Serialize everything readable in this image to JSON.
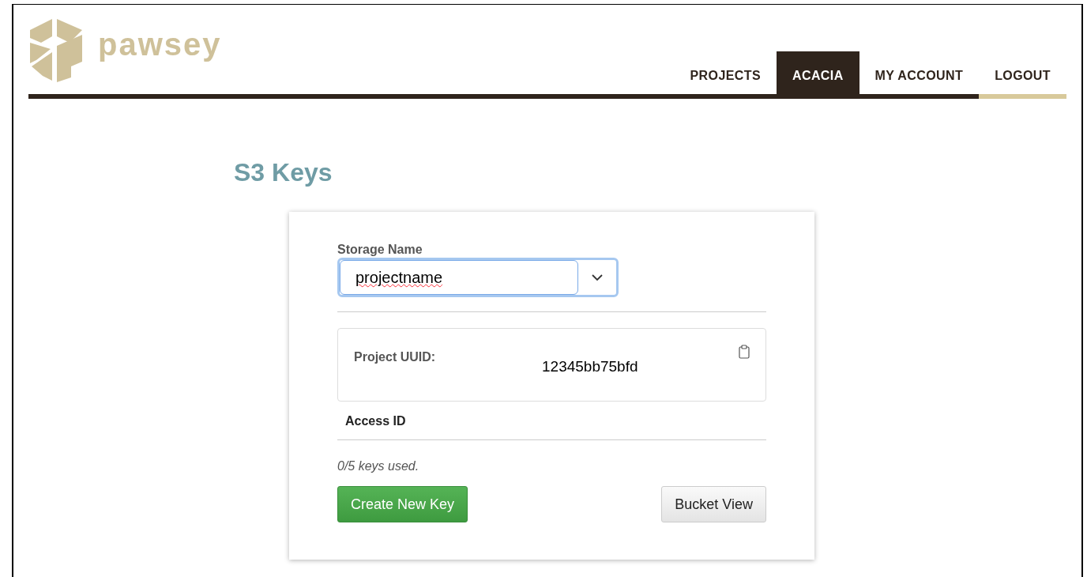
{
  "logo": {
    "wordmark": "pawsey"
  },
  "nav": [
    {
      "label": "PROJECTS",
      "selected": false,
      "color": "#2f241c"
    },
    {
      "label": "ACACIA",
      "selected": true,
      "color": "#2f241c"
    },
    {
      "label": "MY ACCOUNT",
      "selected": false,
      "color": "#2f241c"
    },
    {
      "label": "LOGOUT",
      "selected": false,
      "color": "#d8c99b"
    }
  ],
  "page_title": "S3 Keys",
  "form": {
    "storage_label": "Storage Name",
    "storage_value": "projectname",
    "uuid_label": "Project UUID:",
    "uuid_value": "12345bb75bfd",
    "access_heading": "Access ID",
    "usage": "0/5 keys used.",
    "buttons": [
      {
        "label": "Create New Key",
        "kind": "primary"
      },
      {
        "label": "Bucket View",
        "kind": "secondary"
      }
    ]
  }
}
